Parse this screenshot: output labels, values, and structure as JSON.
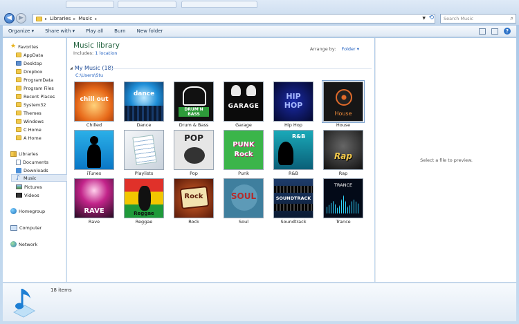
{
  "address": {
    "crumbs": [
      "Libraries",
      "Music"
    ],
    "search_placeholder": "Search Music"
  },
  "toolbar": {
    "organize": "Organize ▾",
    "share_with": "Share with ▾",
    "play_all": "Play all",
    "burn": "Burn",
    "new_folder": "New folder"
  },
  "nav": {
    "favorites": "Favorites",
    "fav_items": [
      "AppData",
      "Desktop",
      "Dropbox",
      "ProgramData",
      "Program Files",
      "Recent Places",
      "System32",
      "Themes",
      "Windows",
      "C Home",
      "A Home"
    ],
    "libraries": "Libraries",
    "lib_items": [
      "Documents",
      "Downloads",
      "Music",
      "Pictures",
      "Videos"
    ],
    "homegroup": "Homegroup",
    "computer": "Computer",
    "network": "Network"
  },
  "library": {
    "title": "Music library",
    "includes_label": "Includes:",
    "includes_link": "1 location",
    "arrange_label": "Arrange by:",
    "arrange_value": "Folder ▾",
    "group": "My Music (18)",
    "path": "C:\\Users\\Stu"
  },
  "folders": [
    {
      "label": "Chilled",
      "art": "chill out"
    },
    {
      "label": "Dance",
      "art": "dance"
    },
    {
      "label": "Drum & Bass",
      "art": "DRUM'N BASS"
    },
    {
      "label": "Garage",
      "art": "GARAGE"
    },
    {
      "label": "Hip Hop",
      "art": "HIP HOP"
    },
    {
      "label": "House",
      "art": "House"
    },
    {
      "label": "iTunes",
      "art": ""
    },
    {
      "label": "Playlists",
      "art": ""
    },
    {
      "label": "Pop",
      "art": "POP"
    },
    {
      "label": "Punk",
      "art": "PUNK Rock"
    },
    {
      "label": "R&B",
      "art": "R&B"
    },
    {
      "label": "Rap",
      "art": "Rap"
    },
    {
      "label": "Rave",
      "art": "RAVE"
    },
    {
      "label": "Reggae",
      "art": "Reggae"
    },
    {
      "label": "Rock",
      "art": "Rock"
    },
    {
      "label": "Soul",
      "art": "SOUL"
    },
    {
      "label": "Soundtrack",
      "art": "SOUNDTRACK"
    },
    {
      "label": "Trance",
      "art": "TRANCE"
    }
  ],
  "preview": {
    "message": "Select a file to preview."
  },
  "status": {
    "count": "18 items"
  },
  "colors": {
    "accent": "#1e5ebf",
    "library_title": "#1e5f3a",
    "selection": "#dfe9f5"
  }
}
